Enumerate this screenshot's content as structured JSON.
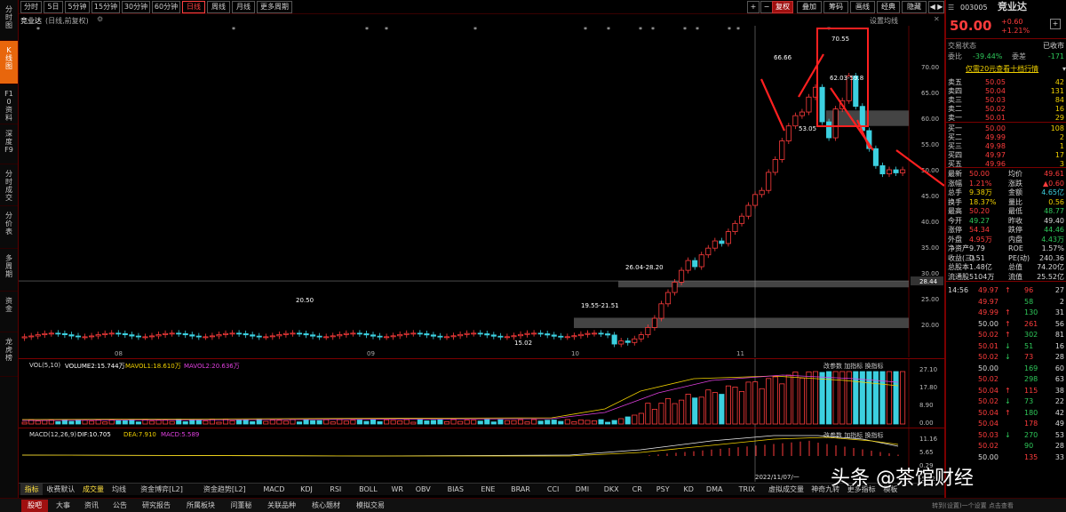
{
  "left_tabs": [
    "分时图",
    "K线图",
    "F10资料",
    "深度F9",
    "分时成交",
    "分价表",
    "多周期",
    "资金",
    "龙虎榜"
  ],
  "periods": [
    "分时",
    "5日",
    "5分钟",
    "15分钟",
    "30分钟",
    "60分钟",
    "日线",
    "周线",
    "月线",
    "更多周期"
  ],
  "active_period": "日线",
  "toolbar": {
    "plus": "+",
    "minus": "−",
    "adjust": "复权",
    "overlay": "叠加",
    "chips": "筹码",
    "draw": "画线",
    "classic": "经典",
    "hide": "隐藏"
  },
  "stock_line": {
    "name": "竞业达",
    "params": "(日线,前复权)",
    "settings": "设置均线"
  },
  "k_axis": [
    "70.00",
    "65.00",
    "60.00",
    "55.00",
    "50.00",
    "45.00",
    "40.00",
    "35.00",
    "30.00",
    "25.00",
    "20.00"
  ],
  "k_marker": "28.44",
  "annotations": {
    "high": "70.55",
    "peak1": "66.66",
    "low": "53.05",
    "gap_top": "62.03-59.8",
    "gap_mid": "26.04-28.20",
    "gap_low": "19.55-21.51",
    "left_mark": "20.50",
    "bottom_mark": "15.02"
  },
  "date_labels": [
    "08",
    "09",
    "10",
    "11"
  ],
  "cursor_date": "2022/11/07/一",
  "vol": {
    "title": "VOL(5,10)",
    "v": "VOLUME2:15.744万",
    "m1": "MAVOL1:18.610万",
    "m2": "MAVOL2:20.636万",
    "tools": "改参数 加指标 换指标",
    "axis": [
      "27.10",
      "17.80",
      "8.90",
      "0.00"
    ]
  },
  "macd": {
    "title": "MACD(12,26,9)",
    "dif": "DIF:10.705",
    "dea": "DEA:7.910",
    "macd": "MACD:5.589",
    "tools": "改参数 加指标 换指标",
    "axis": [
      "11.16",
      "5.65",
      "0.29",
      "-5.22"
    ]
  },
  "bottom_tabs": [
    "指标",
    "收费默认",
    "成交量",
    "均线",
    "资金博弈[L2]",
    "资金趋势[L2]",
    "MACD",
    "KDJ",
    "RSI",
    "BOLL",
    "WR",
    "OBV",
    "BIAS",
    "ENE",
    "BRAR",
    "CCI",
    "DMI",
    "DKX",
    "CR",
    "PSY",
    "KD",
    "DMA",
    "TRIX",
    "虚拟成交量",
    "神奇九转",
    "更多指标",
    "模板"
  ],
  "status_items": [
    "股吧",
    "大事",
    "资讯",
    "公告",
    "研究报告",
    "所属板块",
    "问董秘",
    "关联品种",
    "核心题材",
    "模拟交易"
  ],
  "status_right": "转到(设置)一个设置 点击查看",
  "quote": {
    "code": "003005",
    "name": "竞业达",
    "price": "50.00",
    "change": "+0.60",
    "pct": "+1.21%",
    "status_label": "交易状态",
    "status": "已收市",
    "wb_label": "委比",
    "wb": "-39.44%",
    "wc_label": "委差",
    "wc": "-171",
    "promo": "仅需20元查看十档行情"
  },
  "asks": [
    [
      "卖五",
      "50.05",
      "42"
    ],
    [
      "卖四",
      "50.04",
      "131"
    ],
    [
      "卖三",
      "50.03",
      "84"
    ],
    [
      "卖二",
      "50.02",
      "16"
    ],
    [
      "卖一",
      "50.01",
      "29"
    ]
  ],
  "bids": [
    [
      "买一",
      "50.00",
      "108"
    ],
    [
      "买二",
      "49.99",
      "2"
    ],
    [
      "买三",
      "49.98",
      "1"
    ],
    [
      "买四",
      "49.97",
      "17"
    ],
    [
      "买五",
      "49.96",
      "3"
    ]
  ],
  "stats": [
    [
      "最新",
      "50.00",
      "均价",
      "49.61"
    ],
    [
      "涨幅",
      "1.21%",
      "涨跌",
      "▲0.60"
    ],
    [
      "总手",
      "9.38万",
      "金额",
      "4.65亿"
    ],
    [
      "换手",
      "18.37%",
      "量比",
      "0.56"
    ],
    [
      "最高",
      "50.20",
      "最低",
      "48.77"
    ],
    [
      "今开",
      "49.27",
      "昨收",
      "49.40"
    ],
    [
      "涨停",
      "54.34",
      "跌停",
      "44.46"
    ],
    [
      "外盘",
      "4.95万",
      "内盘",
      "4.43万"
    ],
    [
      "净资产",
      "9.79",
      "ROE",
      "1.57%"
    ],
    [
      "收益(三)",
      "0.51",
      "PE(动)",
      "240.36"
    ],
    [
      "总股本",
      "1.48亿",
      "总值",
      "74.20亿"
    ],
    [
      "流通股",
      "5104万",
      "流值",
      "25.52亿"
    ]
  ],
  "ticks": [
    [
      "14:56",
      "49.97",
      "↑",
      "96",
      "27"
    ],
    [
      "",
      "49.97",
      "",
      "58",
      "2"
    ],
    [
      "",
      "49.99",
      "↑",
      "130",
      "31"
    ],
    [
      "",
      "50.00",
      "↑",
      "261",
      "56"
    ],
    [
      "",
      "50.02",
      "↑",
      "302",
      "81"
    ],
    [
      "",
      "50.01",
      "↓",
      "51",
      "16"
    ],
    [
      "",
      "50.02",
      "↓",
      "73",
      "28"
    ],
    [
      "",
      "50.00",
      "",
      "169",
      "60"
    ],
    [
      "",
      "50.02",
      "",
      "298",
      "63"
    ],
    [
      "",
      "50.04",
      "↑",
      "115",
      "38"
    ],
    [
      "",
      "50.02",
      "↓",
      "73",
      "22"
    ],
    [
      "",
      "50.04",
      "↑",
      "180",
      "42"
    ],
    [
      "",
      "50.04",
      "",
      "178",
      "49"
    ],
    [
      "",
      "50.03",
      "↓",
      "270",
      "53"
    ],
    [
      "",
      "50.02",
      "",
      "90",
      "28"
    ],
    [
      "",
      "50.00",
      "",
      "135",
      "33"
    ]
  ],
  "watermark": "头条 @茶馆财经",
  "colors": {
    "up": "#ff3c3c",
    "down": "#2ec85a",
    "flat_line": "#3cd0e0",
    "accent": "#e8660c"
  }
}
